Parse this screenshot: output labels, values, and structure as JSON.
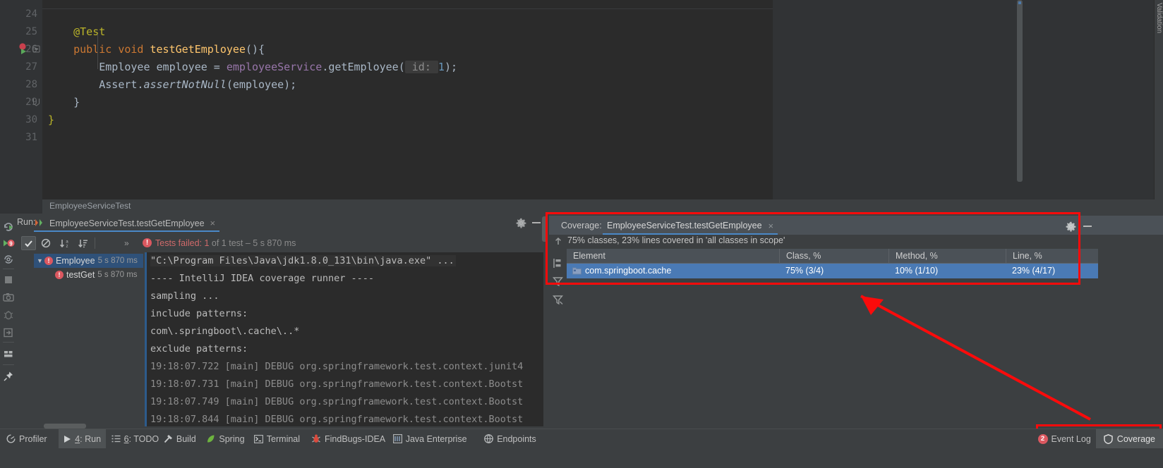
{
  "editor": {
    "lines": [
      {
        "num": "24",
        "tokens": []
      },
      {
        "num": "25",
        "tokens": [
          {
            "t": "    @Test",
            "c": "k-ann"
          }
        ]
      },
      {
        "num": "26",
        "tokens": [
          {
            "t": "    ",
            "c": "k-txt"
          },
          {
            "t": "public",
            "c": "k-kw"
          },
          {
            "t": " ",
            "c": "k-txt"
          },
          {
            "t": "void",
            "c": "k-kw"
          },
          {
            "t": " ",
            "c": "k-txt"
          },
          {
            "t": "testGetEmployee",
            "c": "k-meth"
          },
          {
            "t": "(){",
            "c": "k-txt"
          }
        ]
      },
      {
        "num": "27",
        "tokens": [
          {
            "t": "        Employee employee = ",
            "c": "k-txt"
          },
          {
            "t": "employeeService",
            "c": "k-fld"
          },
          {
            "t": ".getEmployee(",
            "c": "k-txt"
          },
          {
            "t": " id: ",
            "c": "hint-chip"
          },
          {
            "t": "1",
            "c": "k-num"
          },
          {
            "t": ");",
            "c": "k-txt"
          }
        ]
      },
      {
        "num": "28",
        "tokens": [
          {
            "t": "        Assert.",
            "c": "k-txt"
          },
          {
            "t": "assertNotNull",
            "c": "k-ital"
          },
          {
            "t": "(employee);",
            "c": "k-txt"
          }
        ]
      },
      {
        "num": "29",
        "tokens": [
          {
            "t": "    }",
            "c": "k-txt"
          }
        ]
      },
      {
        "num": "30",
        "tokens": [
          {
            "t": "}",
            "c": "k-ann"
          }
        ]
      },
      {
        "num": "31",
        "tokens": []
      }
    ],
    "validation_label": "Validation",
    "breadcrumb": "EmployeeServiceTest"
  },
  "run_panel": {
    "label": "Run:",
    "tab_title": "EmployeeServiceTest.testGetEmployee",
    "tab_close": "×",
    "chevrons": "»",
    "status_prefix": "Tests failed:",
    "status_count": "1",
    "status_mid": " of 1 test – ",
    "status_time": "5 s 870 ms",
    "status_full": "Tests failed: 1 of 1 test – 5 s 870 ms",
    "error_glyph": "!",
    "toolbar_icons": [
      "rerun-failed-tests-icon",
      "check-icon",
      "hide-passed-icon",
      "sort-alphabetically-icon",
      "sort-by-duration-icon"
    ],
    "tree": [
      {
        "arrow": "▼",
        "name": "Employee",
        "time": "5 s 870 ms",
        "selected": true
      },
      {
        "arrow": "",
        "name": "testGet",
        "time": "5 s 870 ms",
        "selected": false
      }
    ],
    "console": [
      {
        "text": "\"C:\\Program Files\\Java\\jdk1.8.0_131\\bin\\java.exe\" ...",
        "style": "cmd"
      },
      {
        "text": "---- IntelliJ IDEA coverage runner ----",
        "style": "plain"
      },
      {
        "text": "sampling ...",
        "style": "plain"
      },
      {
        "text": "include patterns:",
        "style": "plain"
      },
      {
        "text": "com\\.springboot\\.cache\\..*",
        "style": "plain"
      },
      {
        "text": "exclude patterns:",
        "style": "plain"
      },
      {
        "text": "19:18:07.722 [main] DEBUG org.springframework.test.context.junit4",
        "style": "dim"
      },
      {
        "text": "19:18:07.731 [main] DEBUG org.springframework.test.context.Bootst",
        "style": "dim"
      },
      {
        "text": "19:18:07.749 [main] DEBUG org.springframework.test.context.Bootst",
        "style": "dim"
      },
      {
        "text": "19:18:07.844 [main] DEBUG org.springframework.test.context.Bootst",
        "style": "dim"
      }
    ]
  },
  "coverage_panel": {
    "label": "Coverage:",
    "tab_title": "EmployeeServiceTest.testGetEmployee",
    "tab_close": "×",
    "summary": "75% classes, 23% lines covered in 'all classes in scope'",
    "columns": [
      "Element",
      "Class, %",
      "Method, %",
      "Line, %"
    ],
    "rows": [
      {
        "element": "com.springboot.cache",
        "class_pct": "75% (3/4)",
        "method_pct": "10% (1/10)",
        "line_pct": "23% (4/17)",
        "selected": true
      }
    ]
  },
  "status_bar": {
    "items": [
      {
        "label": "Profiler",
        "icon": "profiler-icon",
        "active": false,
        "num": ""
      },
      {
        "label": ": Run",
        "icon": "run-icon",
        "active": true,
        "num": "4"
      },
      {
        "label": ": TODO",
        "icon": "todo-icon",
        "active": false,
        "num": "6"
      },
      {
        "label": "Build",
        "icon": "build-hammer-icon",
        "active": false,
        "num": ""
      },
      {
        "label": "Spring",
        "icon": "spring-leaf-icon",
        "active": false,
        "num": ""
      },
      {
        "label": "Terminal",
        "icon": "terminal-icon",
        "active": false,
        "num": ""
      },
      {
        "label": "FindBugs-IDEA",
        "icon": "findbugs-icon",
        "active": false,
        "num": ""
      },
      {
        "label": "Java Enterprise",
        "icon": "java-enterprise-icon",
        "active": false,
        "num": ""
      },
      {
        "label": "Endpoints",
        "icon": "endpoints-icon",
        "active": false,
        "num": ""
      }
    ],
    "event_log": {
      "label": "Event Log",
      "badge": "2"
    },
    "coverage": {
      "label": "Coverage",
      "icon": "shield-icon"
    }
  },
  "colors": {
    "accent_blue": "#4a88c7",
    "selection_blue": "#4a7ab5",
    "error_red": "#db5860",
    "annotation_red": "#fb0b0b",
    "panel_bg": "#3c3f41",
    "editor_bg": "#2b2b2b",
    "console_bg": "#2b2b2b"
  }
}
